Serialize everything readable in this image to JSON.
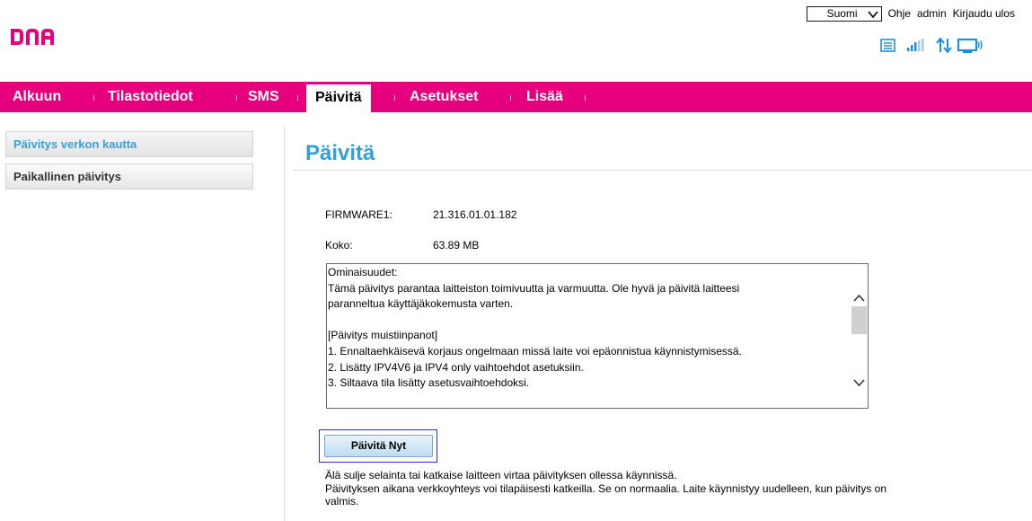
{
  "brand": {
    "logo_text": "DNA",
    "accent": "#e6007e",
    "title_color": "#31a1d8"
  },
  "header": {
    "language": "Suomi",
    "links": [
      "Ohje",
      "admin",
      "Kirjaudu ulos"
    ]
  },
  "status_icons": [
    "sms-list-icon",
    "signal-strength-icon",
    "data-transfer-icon",
    "connected-device-icon"
  ],
  "nav": {
    "items": [
      {
        "label": "Alkuun",
        "active": false
      },
      {
        "label": "Tilastotiedot",
        "active": false
      },
      {
        "label": "SMS",
        "active": false
      },
      {
        "label": "Päivitä",
        "active": true
      },
      {
        "label": "Asetukset",
        "active": false
      },
      {
        "label": "Lisää",
        "active": false
      }
    ]
  },
  "sidebar": {
    "items": [
      {
        "label": "Päivitys verkon kautta",
        "selected": true
      },
      {
        "label": "Paikallinen päivitys",
        "selected": false
      }
    ]
  },
  "main": {
    "title": "Päivitä",
    "firmware_label": "FIRMWARE1:",
    "firmware_value": "21.316.01.01.182",
    "size_label": "Koko:",
    "size_value": "63.89 MB",
    "notes": {
      "lines": [
        "Ominaisuudet:",
        "Tämä päivitys parantaa laitteiston toimivuutta ja varmuutta. Ole hyvä ja päivitä laitteesi",
        "paranneltua käyttäjäkokemusta varten.",
        "",
        "[Päivitys muistiinpanot]",
        "1. Ennaltaehkäisevä korjaus ongelmaan missä laite voi epäonnistua käynnistymisessä.",
        "2. Lisätty IPV4V6 ja IPV4 only vaihtoehdot asetuksiin.",
        "3. Siltaava tila lisätty asetusvaihtoehdoksi."
      ]
    },
    "update_button": "Päivitä Nyt",
    "warning_line1": "Älä sulje selainta tai katkaise laitteen virtaa päivityksen ollessa käynnissä.",
    "warning_line2": "Päivityksen aikana verkkoyhteys voi tilapäisesti katkeilla. Se on normaalia. Laite käynnistyy uudelleen, kun päivitys on",
    "warning_line3": "valmis."
  }
}
